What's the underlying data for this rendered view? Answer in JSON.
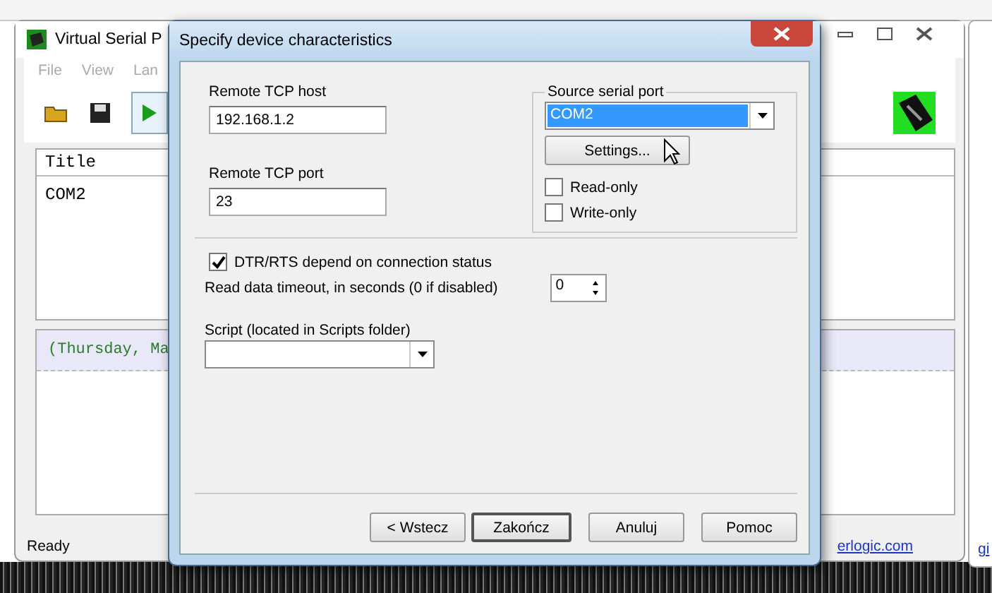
{
  "background_window": {
    "title": "Virtual Serial P",
    "menu": [
      "File",
      "View",
      "Lan"
    ],
    "table": {
      "columns": [
        "Title"
      ],
      "rows": [
        "COM2"
      ]
    },
    "log": [
      "(Thursday, Ma"
    ],
    "status_bar": "Ready",
    "link": "erlogic.com"
  },
  "second_window": {
    "link": "gi"
  },
  "dialog": {
    "title": "Specify device characteristics",
    "host": {
      "label": "Remote TCP host",
      "value": "192.168.1.2"
    },
    "port": {
      "label": "Remote TCP port",
      "value": "23"
    },
    "source": {
      "label": "Source serial port",
      "value": "COM2",
      "button": "Settings...",
      "options": [
        {
          "label": "Read-only",
          "checked": false
        },
        {
          "label": "Write-only",
          "checked": false
        }
      ]
    },
    "dtr": {
      "label": "DTR/RTS depend on connection status",
      "checked": true
    },
    "timeout": {
      "label": "Read data timeout, in seconds (0 if disabled)",
      "value": "0"
    },
    "script": {
      "label": "Script (located in Scripts folder)"
    },
    "buttons": [
      {
        "label": "< Wstecz",
        "default": false
      },
      {
        "label": "Zakończ",
        "default": true
      },
      {
        "label": "Anuluj",
        "default": false
      },
      {
        "label": "Pomoc",
        "default": false
      }
    ]
  }
}
